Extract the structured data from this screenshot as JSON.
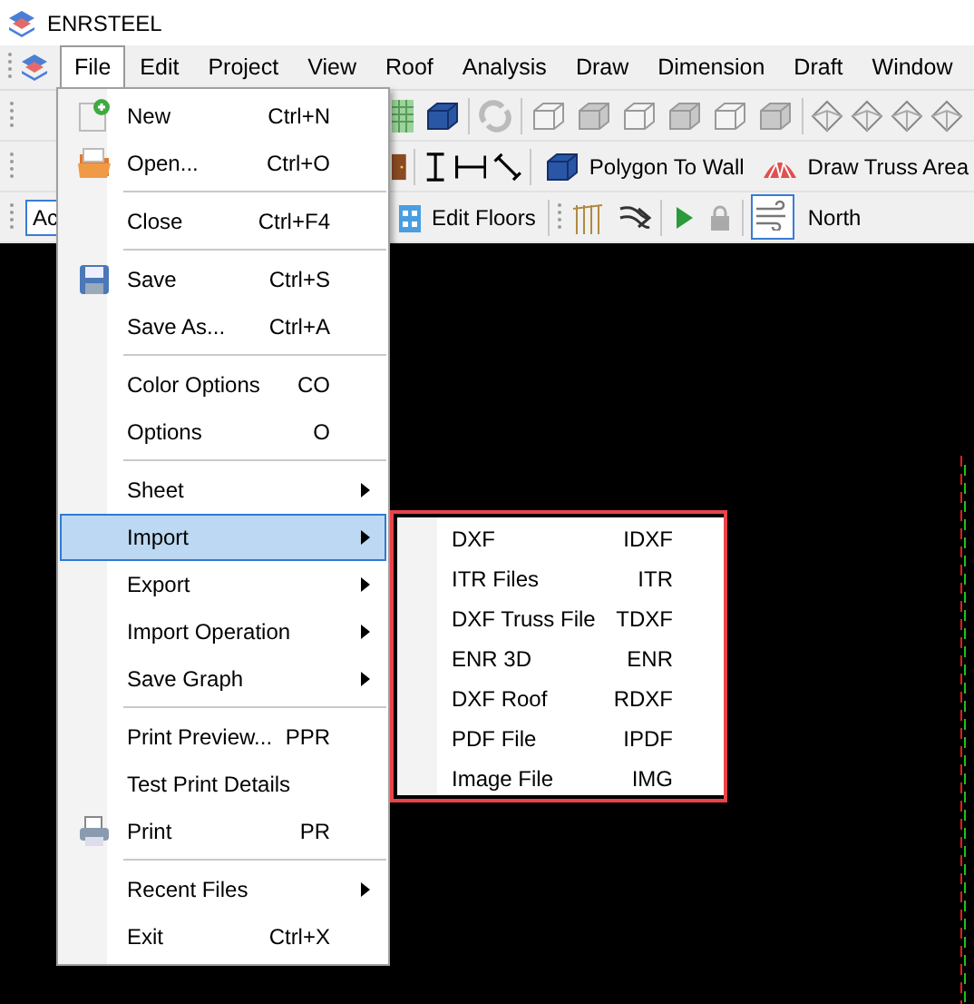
{
  "window": {
    "title": "ENRSTEEL"
  },
  "menubar": [
    {
      "label": "File",
      "selected": true
    },
    {
      "label": "Edit",
      "selected": false
    },
    {
      "label": "Project",
      "selected": false
    },
    {
      "label": "View",
      "selected": false
    },
    {
      "label": "Roof",
      "selected": false
    },
    {
      "label": "Analysis",
      "selected": false
    },
    {
      "label": "Draw",
      "selected": false
    },
    {
      "label": "Dimension",
      "selected": false
    },
    {
      "label": "Draft",
      "selected": false
    },
    {
      "label": "Window",
      "selected": false
    }
  ],
  "toolbar": {
    "field_value": "Ac",
    "polygon_button": "Polygon To Wall",
    "truss_button": "Draw Truss Area",
    "floors_button": "Edit Floors",
    "wind_toggle": {
      "checked": true
    },
    "direction": "North"
  },
  "file_menu": [
    {
      "kind": "item",
      "label": "New",
      "shortcut": "Ctrl+N"
    },
    {
      "kind": "item",
      "label": "Open...",
      "shortcut": "Ctrl+O"
    },
    {
      "kind": "separator"
    },
    {
      "kind": "item",
      "label": "Close",
      "shortcut": "Ctrl+F4"
    },
    {
      "kind": "separator"
    },
    {
      "kind": "item",
      "label": "Save",
      "shortcut": "Ctrl+S"
    },
    {
      "kind": "item",
      "label": "Save As...",
      "shortcut": "Ctrl+A"
    },
    {
      "kind": "separator"
    },
    {
      "kind": "item",
      "label": "Color Options",
      "shortcut": "CO"
    },
    {
      "kind": "item",
      "label": "Options",
      "shortcut": "O"
    },
    {
      "kind": "separator"
    },
    {
      "kind": "submenu",
      "label": "Sheet",
      "selected": false
    },
    {
      "kind": "submenu",
      "label": "Import",
      "selected": true
    },
    {
      "kind": "submenu",
      "label": "Export",
      "selected": false
    },
    {
      "kind": "submenu",
      "label": "Import Operation",
      "selected": false
    },
    {
      "kind": "submenu",
      "label": "Save Graph",
      "selected": false
    },
    {
      "kind": "separator"
    },
    {
      "kind": "item",
      "label": "Print Preview...",
      "shortcut": "PPR"
    },
    {
      "kind": "item",
      "label": "Test Print Details"
    },
    {
      "kind": "item",
      "label": "Print",
      "shortcut": "PR"
    },
    {
      "kind": "separator"
    },
    {
      "kind": "submenu",
      "label": "Recent Files",
      "selected": false
    },
    {
      "kind": "item",
      "label": "Exit",
      "shortcut": "Ctrl+X"
    }
  ],
  "import_submenu": [
    {
      "label": "DXF",
      "shortcut": "IDXF"
    },
    {
      "label": "ITR Files",
      "shortcut": "ITR"
    },
    {
      "label": "DXF Truss File",
      "shortcut": "TDXF"
    },
    {
      "label": "ENR 3D",
      "shortcut": "ENR"
    },
    {
      "label": "DXF Roof",
      "shortcut": "RDXF"
    },
    {
      "label": "PDF File",
      "shortcut": "IPDF"
    },
    {
      "label": "Image File",
      "shortcut": "IMG"
    }
  ]
}
